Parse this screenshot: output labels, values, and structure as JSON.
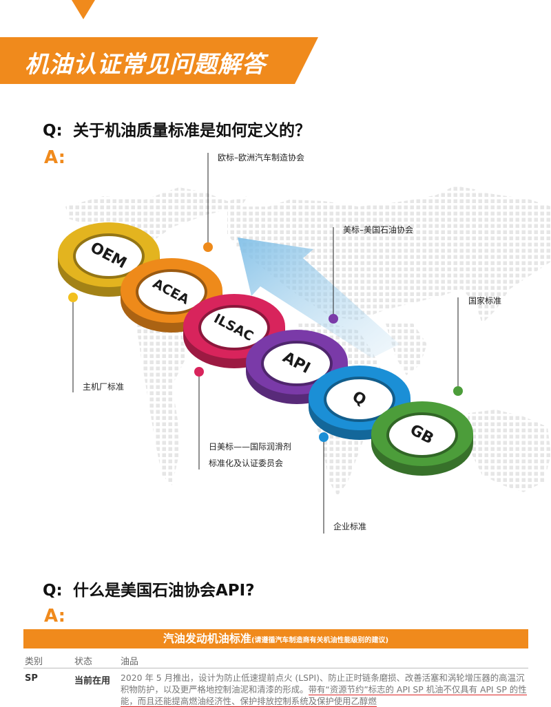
{
  "page": {
    "title": "机油认证常见问题解答",
    "accent_color": "#f08a1c"
  },
  "q1": {
    "q": "Q:",
    "text": "关于机油质量标准是如何定义的？",
    "a": "A:"
  },
  "diagram": {
    "rings": [
      {
        "label": "OEM",
        "color": "#e3b41f"
      },
      {
        "label": "ACEA",
        "color": "#ee8a1a"
      },
      {
        "label": "ILSAC",
        "color": "#d8245c"
      },
      {
        "label": "API",
        "color": "#7a3aa8"
      },
      {
        "label": "Q",
        "color": "#1b8fd6"
      },
      {
        "label": "GB",
        "color": "#4c9d3a"
      }
    ],
    "labels": {
      "acea": "欧标–欧洲汽车制造协会",
      "api": "美标–美国石油协会",
      "gb": "国家标准",
      "oem": "主机厂标准",
      "ilsac_line1": "日美标——国际润滑剂",
      "ilsac_line2": "标准化及认证委员会",
      "q": "企业标准"
    }
  },
  "q2": {
    "q": "Q:",
    "text": "什么是美国石油协会API?",
    "a": "A:"
  },
  "table": {
    "title": "汽油发动机油标准",
    "subtitle": "(请遵循汽车制造商有关机油性能级别的建议)",
    "columns": [
      "类别",
      "状态",
      "油品"
    ],
    "rows": [
      {
        "category": "SP",
        "status": "当前在用",
        "desc_plain": "2020 年 5 月推出，设计为防止低速提前点火 (LSPI)、防止正时链条磨损、改善活塞和涡轮增压器的高温沉积物防护，以及更严格地控制油泥和清漆的形成。",
        "desc_highlight": "带有“资源节约”标志的 API SP 机油不仅具有 API SP 的性能，而且还能提高燃油经济性、保护排放控制系统及保护使用乙醇燃"
      }
    ]
  }
}
